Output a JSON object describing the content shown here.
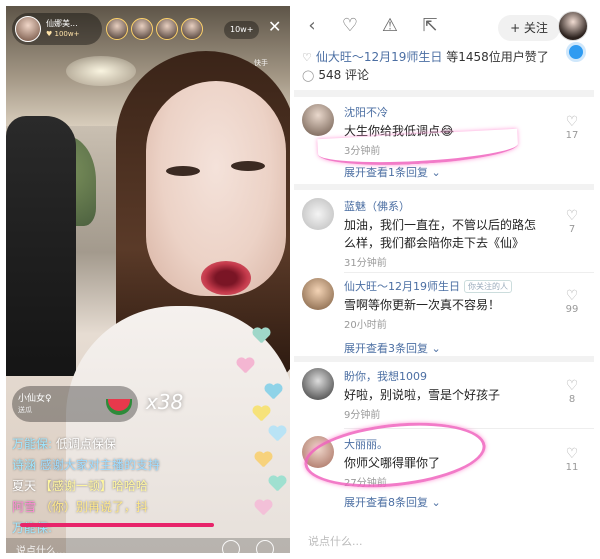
{
  "live": {
    "host_name": "仙娜美...",
    "host_fans": "100w+",
    "viewer_count": "10w+",
    "corner_tag": "快手",
    "gift_chip": {
      "line1": "小仙女♀",
      "line2": "送瓜",
      "combo": "x38",
      "icon": "watermelon-icon"
    },
    "chat": [
      {
        "name": "万能保:",
        "msg": "低调点保保"
      },
      {
        "name": "诗涵",
        "msg": "感谢大家对主播的支持"
      },
      {
        "name": "夏天",
        "msg": "【感谢一顿】哈哈哈"
      },
      {
        "name": "阿雪",
        "msg": "（你）别再说了，抖"
      },
      {
        "name": "万能保:",
        "msg": ""
      }
    ],
    "say_placeholder": "说点什么..."
  },
  "detail": {
    "follow_label": "+ 关注",
    "likes_highlight": "仙大旺～12月19师生日",
    "likes_rest": " 等1458位用户赞了",
    "comment_count": "548 评论",
    "bottom_placeholder": "说点什么...",
    "comments": [
      {
        "name": "沈阳不冷",
        "tag": "",
        "text": "大生你给我低调点😂",
        "time": "3分钟前",
        "likes": "17",
        "expand": "展开查看1条回复 ⌄"
      },
      {
        "name": "蓝魅（佛系）",
        "tag": "",
        "text": "加油，我们一直在，不管以后的路怎么样，我们都会陪你走下去《仙》",
        "time": "31分钟前",
        "likes": "7",
        "expand": ""
      },
      {
        "name": "仙大旺～12月19师生日",
        "tag": "你关注的人",
        "text": "雪啊等你更新一次真不容易！",
        "time": "20小时前",
        "likes": "99",
        "expand": "展开查看3条回复 ⌄"
      },
      {
        "name": "盼你，我想1009",
        "tag": "",
        "text": "好啦，别说啦，雪是个好孩子",
        "time": "9分钟前",
        "likes": "8",
        "expand": ""
      },
      {
        "name": "大丽丽。",
        "tag": "",
        "text": "你师父哪得罪你了",
        "time": "27分钟前",
        "likes": "11",
        "expand": "展开查看8条回复 ⌄"
      }
    ]
  },
  "colors": {
    "accent_link": "#4c6fa3",
    "highlight_pink": "#f064be",
    "underline_red": "#e8246a"
  }
}
